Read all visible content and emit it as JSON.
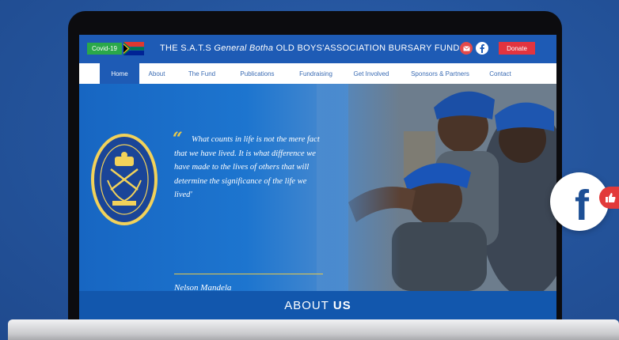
{
  "banner": {
    "covid_label": "Covid-19",
    "title_prefix": "THE S.A.T.S ",
    "title_italic": "General Botha",
    "title_suffix": " OLD BOYS'ASSOCIATION BURSARY FUND",
    "donate_label": "Donate"
  },
  "nav": {
    "items": [
      {
        "label": "Home",
        "active": true
      },
      {
        "label": "About"
      },
      {
        "label": "The Fund"
      },
      {
        "label": "Publications"
      },
      {
        "label": "Fundraising"
      },
      {
        "label": "Get Involved"
      },
      {
        "label": "Sponsors & Partners"
      },
      {
        "label": "Contact"
      }
    ]
  },
  "hero": {
    "quote_mark": "“",
    "quote": "What counts in life is not the mere fact that we have lived. It is what difference we have made to the lives of others that will determine the significance of the life we lived'",
    "author": "Nelson Mandela"
  },
  "about": {
    "prefix": "ABOUT",
    "bold": "US"
  },
  "icons": {
    "mail": "mail-icon",
    "facebook": "facebook-icon",
    "flag": "south-africa-flag-icon",
    "badge": "association-crest"
  },
  "colors": {
    "brand_blue": "#1e5bb5",
    "donate_red": "#e2343f",
    "covid_green": "#2aa84a",
    "accent_gold": "#e7c94a",
    "page_bg": "#24549c"
  }
}
